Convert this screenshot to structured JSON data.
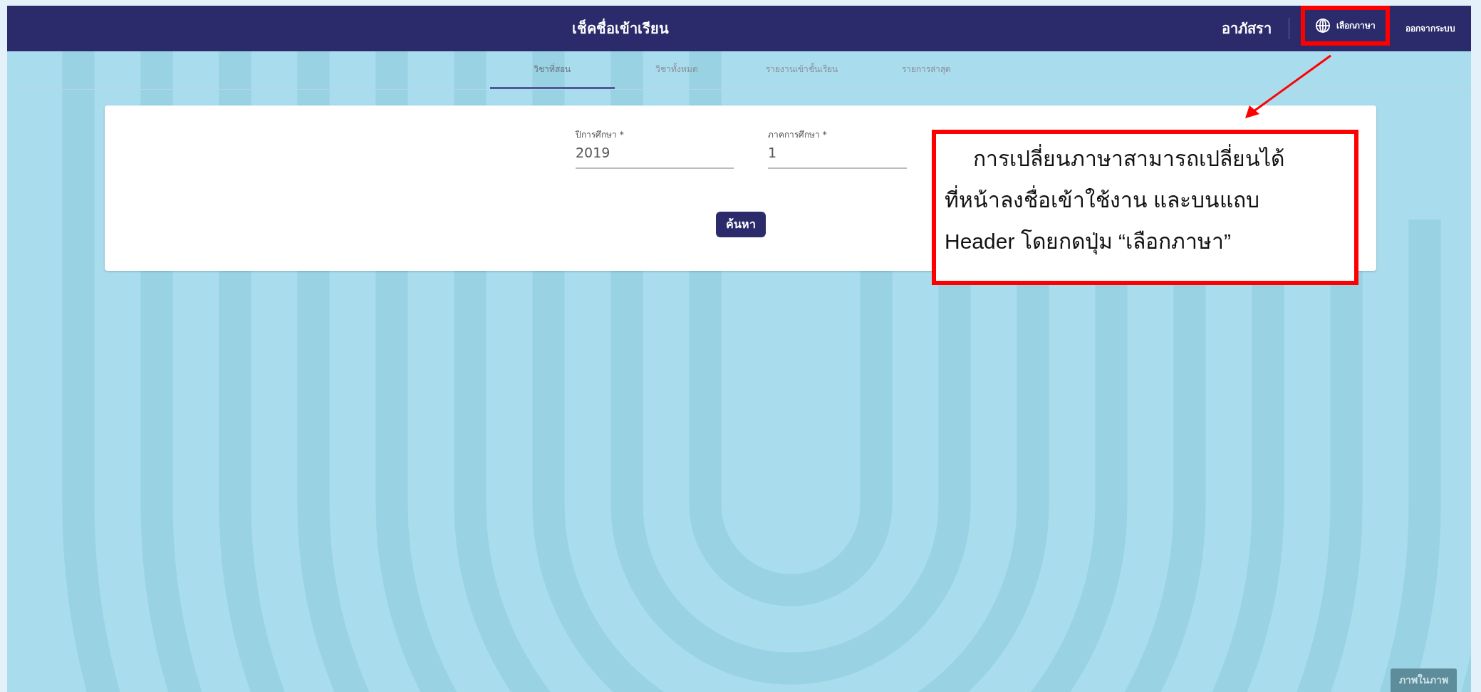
{
  "header": {
    "title": "เช็คชื่อเข้าเรียน",
    "user": "อาภัสรา",
    "language_button": "เลือกภาษา",
    "logout": "ออกจากระบบ"
  },
  "tabs": [
    {
      "label": "วิชาที่สอน",
      "selected": true
    },
    {
      "label": "วิชาทั้งหมด",
      "selected": false
    },
    {
      "label": "รายงานเข้าชั้นเรียน",
      "selected": false
    },
    {
      "label": "รายการล่าสุด",
      "selected": false
    }
  ],
  "search_form": {
    "fields": [
      {
        "label": "ปีการศึกษา *",
        "value": "2019"
      },
      {
        "label": "ภาคการศึกษา *",
        "value": "1"
      }
    ],
    "button": "ค้นหา"
  },
  "annotation": {
    "lines": [
      "การเปลี่ยนภาษาสามารถเปลี่ยนได้",
      "ที่หน้าลงชื่อเข้าใช้งาน และบนแถบ",
      "Header โดยกดปุ่ม “เลือกภาษา”"
    ]
  },
  "pip_button": "ภาพในภาพ"
}
